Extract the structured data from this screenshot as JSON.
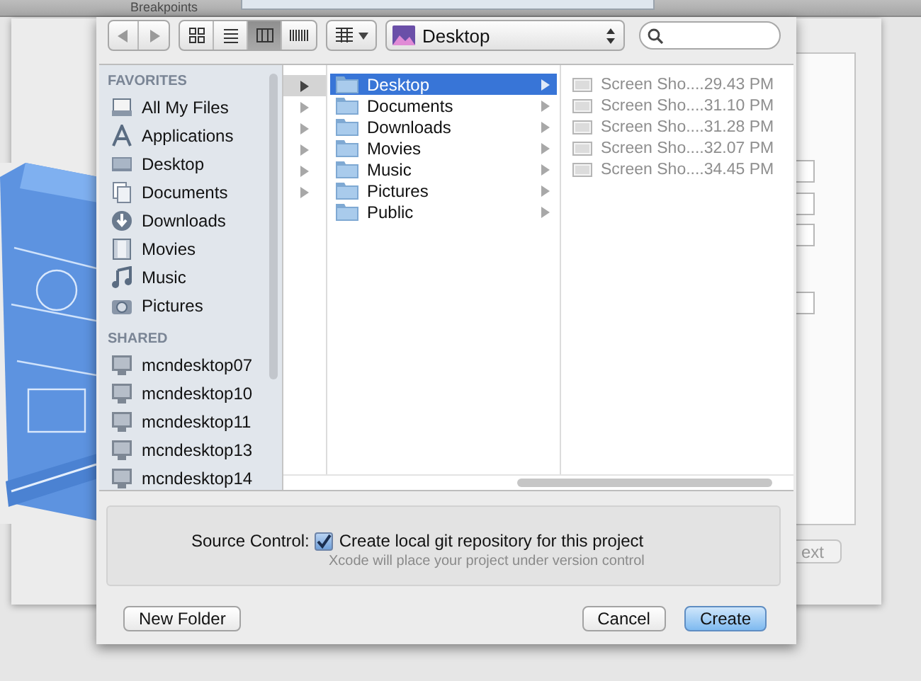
{
  "background_window": {
    "top_bar_label": "Breakpoints",
    "next_button": "ext"
  },
  "sheet": {
    "toolbar": {
      "view_modes": [
        {
          "selected": false
        },
        {
          "selected": false
        },
        {
          "selected": true
        },
        {
          "selected": false
        }
      ],
      "path_popup": {
        "label": "Desktop"
      }
    },
    "sidebar": {
      "sections": [
        {
          "title": "FAVORITES",
          "items": [
            {
              "label": "All My Files"
            },
            {
              "label": "Applications"
            },
            {
              "label": "Desktop"
            },
            {
              "label": "Documents"
            },
            {
              "label": "Downloads"
            },
            {
              "label": "Movies"
            },
            {
              "label": "Music"
            },
            {
              "label": "Pictures"
            }
          ]
        },
        {
          "title": "SHARED",
          "items": [
            {
              "label": "mcndesktop07"
            },
            {
              "label": "mcndesktop10"
            },
            {
              "label": "mcndesktop11"
            },
            {
              "label": "mcndesktop13"
            },
            {
              "label": "mcndesktop14"
            }
          ]
        }
      ]
    },
    "column_1": [
      {
        "selected": true
      },
      {
        "selected": false
      },
      {
        "selected": false
      },
      {
        "selected": false
      },
      {
        "selected": false
      },
      {
        "selected": false
      }
    ],
    "column_2": [
      {
        "label": "Desktop",
        "selected": true
      },
      {
        "label": "Documents",
        "selected": false
      },
      {
        "label": "Downloads",
        "selected": false
      },
      {
        "label": "Movies",
        "selected": false
      },
      {
        "label": "Music",
        "selected": false
      },
      {
        "label": "Pictures",
        "selected": false
      },
      {
        "label": "Public",
        "selected": false
      }
    ],
    "column_3": [
      {
        "label": "Screen Sho....29.43 PM",
        "disabled": true
      },
      {
        "label": "Screen Sho....31.10 PM",
        "disabled": true
      },
      {
        "label": "Screen Sho....31.28 PM",
        "disabled": true
      },
      {
        "label": "Screen Sho....32.07 PM",
        "disabled": true
      },
      {
        "label": "Screen Sho....34.45 PM",
        "disabled": true
      }
    ],
    "source_control": {
      "label": "Source Control:",
      "checkbox": {
        "label": "Create local git repository for this project",
        "checked": true
      },
      "note": "Xcode will place your project under version control"
    },
    "buttons": [
      {
        "label": "New Folder",
        "default": false
      },
      {
        "label": "Cancel",
        "default": false
      },
      {
        "label": "Create",
        "default": true
      }
    ]
  }
}
